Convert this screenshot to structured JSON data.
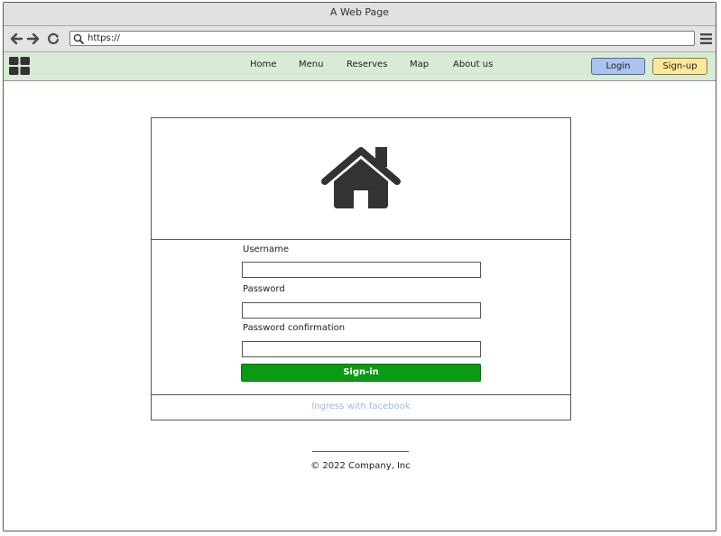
{
  "window": {
    "title": "A Web Page"
  },
  "browser": {
    "url": "https://",
    "back_icon": "arrow-left-icon",
    "forward_icon": "arrow-right-icon",
    "reload_icon": "reload-icon",
    "search_icon": "search-icon",
    "menu_icon": "hamburger-menu-icon"
  },
  "navbar": {
    "logo_icon": "grid-logo-icon",
    "links": [
      {
        "label": "Home"
      },
      {
        "label": "Menu"
      },
      {
        "label": "Reserves"
      },
      {
        "label": "Map"
      },
      {
        "label": "About us"
      }
    ],
    "login_label": "Login",
    "signup_label": "Sign-up",
    "background_color": "#d8ebd4",
    "login_color": "#a9c4f0",
    "signup_color": "#fde79a"
  },
  "form": {
    "hero_icon": "house-icon",
    "username_label": "Username",
    "username_value": "",
    "password_label": "Password",
    "password_value": "",
    "password_confirm_label": "Password confirmation",
    "password_confirm_value": "",
    "submit_label": "Sign-in",
    "submit_color": "#0a9a14",
    "facebook_link": "Ingress with facebook"
  },
  "footer": {
    "copyright": "© 2022 Company, Inc"
  }
}
